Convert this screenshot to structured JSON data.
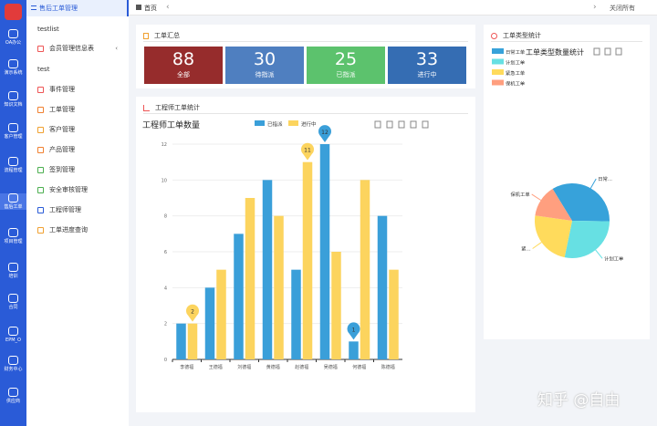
{
  "apps": [
    {
      "label": "OA办公",
      "icon": "app-icon",
      "active": false
    },
    {
      "label": "演示系统",
      "icon": "app-icon",
      "active": false
    },
    {
      "label": "知识文档",
      "icon": "app-icon",
      "active": false
    },
    {
      "label": "客户管理",
      "icon": "app-icon",
      "active": false
    },
    {
      "label": "流程管理",
      "icon": "app-icon",
      "active": false
    },
    {
      "label": "售后工单",
      "icon": "app-icon",
      "active": true
    },
    {
      "label": "项目管理",
      "icon": "app-icon",
      "active": false
    },
    {
      "label": "培训",
      "icon": "app-icon",
      "active": false
    },
    {
      "label": "合同",
      "icon": "app-icon",
      "active": false
    },
    {
      "label": "EPM_O",
      "icon": "app-icon",
      "active": false
    },
    {
      "label": "财务中心",
      "icon": "app-icon",
      "active": false
    },
    {
      "label": "供应商",
      "icon": "app-icon",
      "active": false
    }
  ],
  "sidebar": {
    "title": "售后工单管理",
    "groups": [
      "testlist",
      "test"
    ],
    "member_menu": "会员管理信息表",
    "items": [
      "事件管理",
      "工单管理",
      "客户管理",
      "产品管理",
      "签到管理",
      "安全审核管理",
      "工程师管理",
      "工单进度查询"
    ]
  },
  "topbar": {
    "home": "首页",
    "close_all": "关闭所有"
  },
  "summary": {
    "title": "工单汇总",
    "stats": [
      {
        "value": "88",
        "label": "全部",
        "color": "#962c2c"
      },
      {
        "value": "30",
        "label": "待指派",
        "color": "#4f7fc0"
      },
      {
        "value": "25",
        "label": "已指派",
        "color": "#5cc26d"
      },
      {
        "value": "33",
        "label": "进行中",
        "color": "#356db3"
      }
    ]
  },
  "eng_card": {
    "title": "工程师工单统计"
  },
  "type_card": {
    "title": "工单类型统计"
  },
  "chart_data": [
    {
      "type": "bar",
      "title": "工程师工单数量",
      "categories": [
        "李德福",
        "王德福",
        "刘德福",
        "黄德福",
        "赵德福",
        "吴德福",
        "何德福",
        "陈德福"
      ],
      "series": [
        {
          "name": "已指派",
          "values": [
            2,
            4,
            7,
            10,
            5,
            12,
            1,
            8
          ],
          "color": "#3a9fd9"
        },
        {
          "name": "进行中",
          "values": [
            2,
            5,
            9,
            8,
            11,
            6,
            10,
            5
          ],
          "color": "#fcd45e"
        }
      ],
      "ylim": [
        0,
        12
      ],
      "yticks": [
        "0",
        "2",
        "4",
        "6",
        "8",
        "10",
        "12"
      ],
      "markers": [
        {
          "label": "2",
          "series": 1,
          "index": 0
        },
        {
          "label": "11",
          "series": 1,
          "index": 4
        },
        {
          "label": "12",
          "series": 0,
          "index": 5
        },
        {
          "label": "1",
          "series": 0,
          "index": 6
        }
      ]
    },
    {
      "type": "pie",
      "title": "工单类型数量统计",
      "legend": [
        {
          "name": "日常工单",
          "color": "#37a2da"
        },
        {
          "name": "计划工单",
          "color": "#67e0e3"
        },
        {
          "name": "紧急工单",
          "color": "#ffdb5c"
        },
        {
          "name": "保机工单",
          "color": "#ff9f7f"
        }
      ],
      "values": [
        34,
        28,
        24,
        14
      ],
      "slice_labels": [
        "日常...",
        "计划工单",
        "紧...",
        "保机工单"
      ]
    }
  ],
  "watermark": "知乎 @自由"
}
